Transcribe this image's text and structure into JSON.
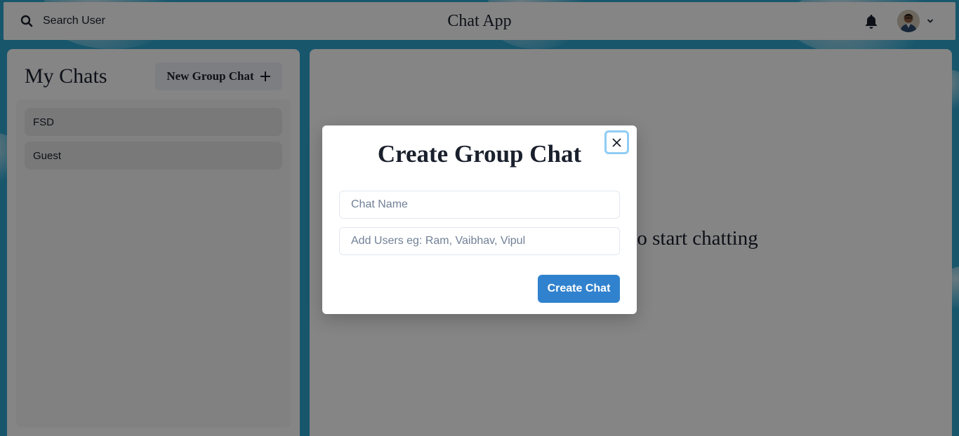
{
  "header": {
    "search_label": "Search User",
    "app_title": "Chat App"
  },
  "chats": {
    "title": "My Chats",
    "new_group_label": "New Group Chat",
    "items": [
      {
        "label": "FSD"
      },
      {
        "label": "Guest"
      }
    ]
  },
  "chat_box": {
    "empty_text": "Click on a user to start chatting"
  },
  "modal": {
    "title": "Create Group Chat",
    "chat_name_placeholder": "Chat Name",
    "add_users_placeholder": "Add Users eg: Ram, Vaibhav, Vipul",
    "create_label": "Create Chat"
  },
  "colors": {
    "accent": "#3182ce",
    "focus_ring": "#90cdf4",
    "background": "#2fa6cf"
  },
  "icons": {
    "search": "search-icon",
    "bell": "bell-icon",
    "chevron": "chevron-down-icon",
    "plus": "plus-icon",
    "close": "close-icon"
  }
}
